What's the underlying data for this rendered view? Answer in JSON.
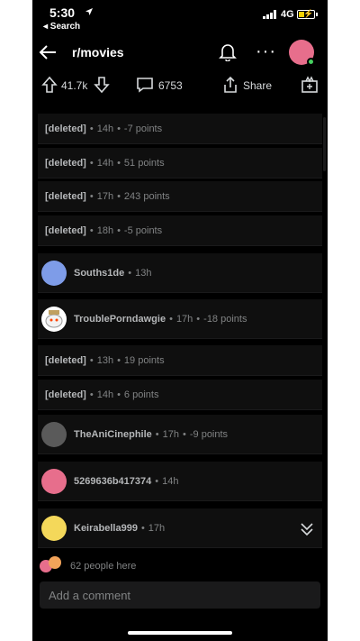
{
  "status_bar": {
    "time": "5:30",
    "back_app": "◂ Search",
    "network": "4G"
  },
  "header": {
    "subreddit": "r/movies"
  },
  "actions": {
    "upvotes": "41.7k",
    "comments": "6753",
    "share_label": "Share"
  },
  "comments": [
    {
      "type": "deleted",
      "user": "[deleted]",
      "age": "14h",
      "points": "-7 points"
    },
    {
      "type": "deleted",
      "user": "[deleted]",
      "age": "14h",
      "points": "51 points"
    },
    {
      "type": "deleted",
      "user": "[deleted]",
      "age": "17h",
      "points": "243 points"
    },
    {
      "type": "deleted",
      "user": "[deleted]",
      "age": "18h",
      "points": "-5 points"
    },
    {
      "type": "user",
      "user": "Souths1de",
      "age": "13h",
      "points": "",
      "avatar_color": "#7e9ce8"
    },
    {
      "type": "user",
      "user": "TroublePorndawgie",
      "age": "17h",
      "points": "-18 points",
      "avatar_color": "#ffffff"
    },
    {
      "type": "deleted",
      "user": "[deleted]",
      "age": "13h",
      "points": "19 points"
    },
    {
      "type": "deleted",
      "user": "[deleted]",
      "age": "14h",
      "points": "6 points"
    },
    {
      "type": "user",
      "user": "TheAniCinephile",
      "age": "17h",
      "points": "-9 points",
      "avatar_color": "#5a5a5a"
    },
    {
      "type": "user",
      "user": "5269636b417374",
      "age": "14h",
      "points": "",
      "avatar_color": "#e76e8c"
    },
    {
      "type": "user",
      "user": "Keirabella999",
      "age": "17h",
      "points": "",
      "avatar_color": "#f4d85a"
    }
  ],
  "footer": {
    "people_here": "62 people here",
    "comment_placeholder": "Add a comment"
  },
  "colors": {
    "background": "#000000",
    "row": "#0f0f0f",
    "muted_text": "#818384",
    "online": "#46d160"
  }
}
